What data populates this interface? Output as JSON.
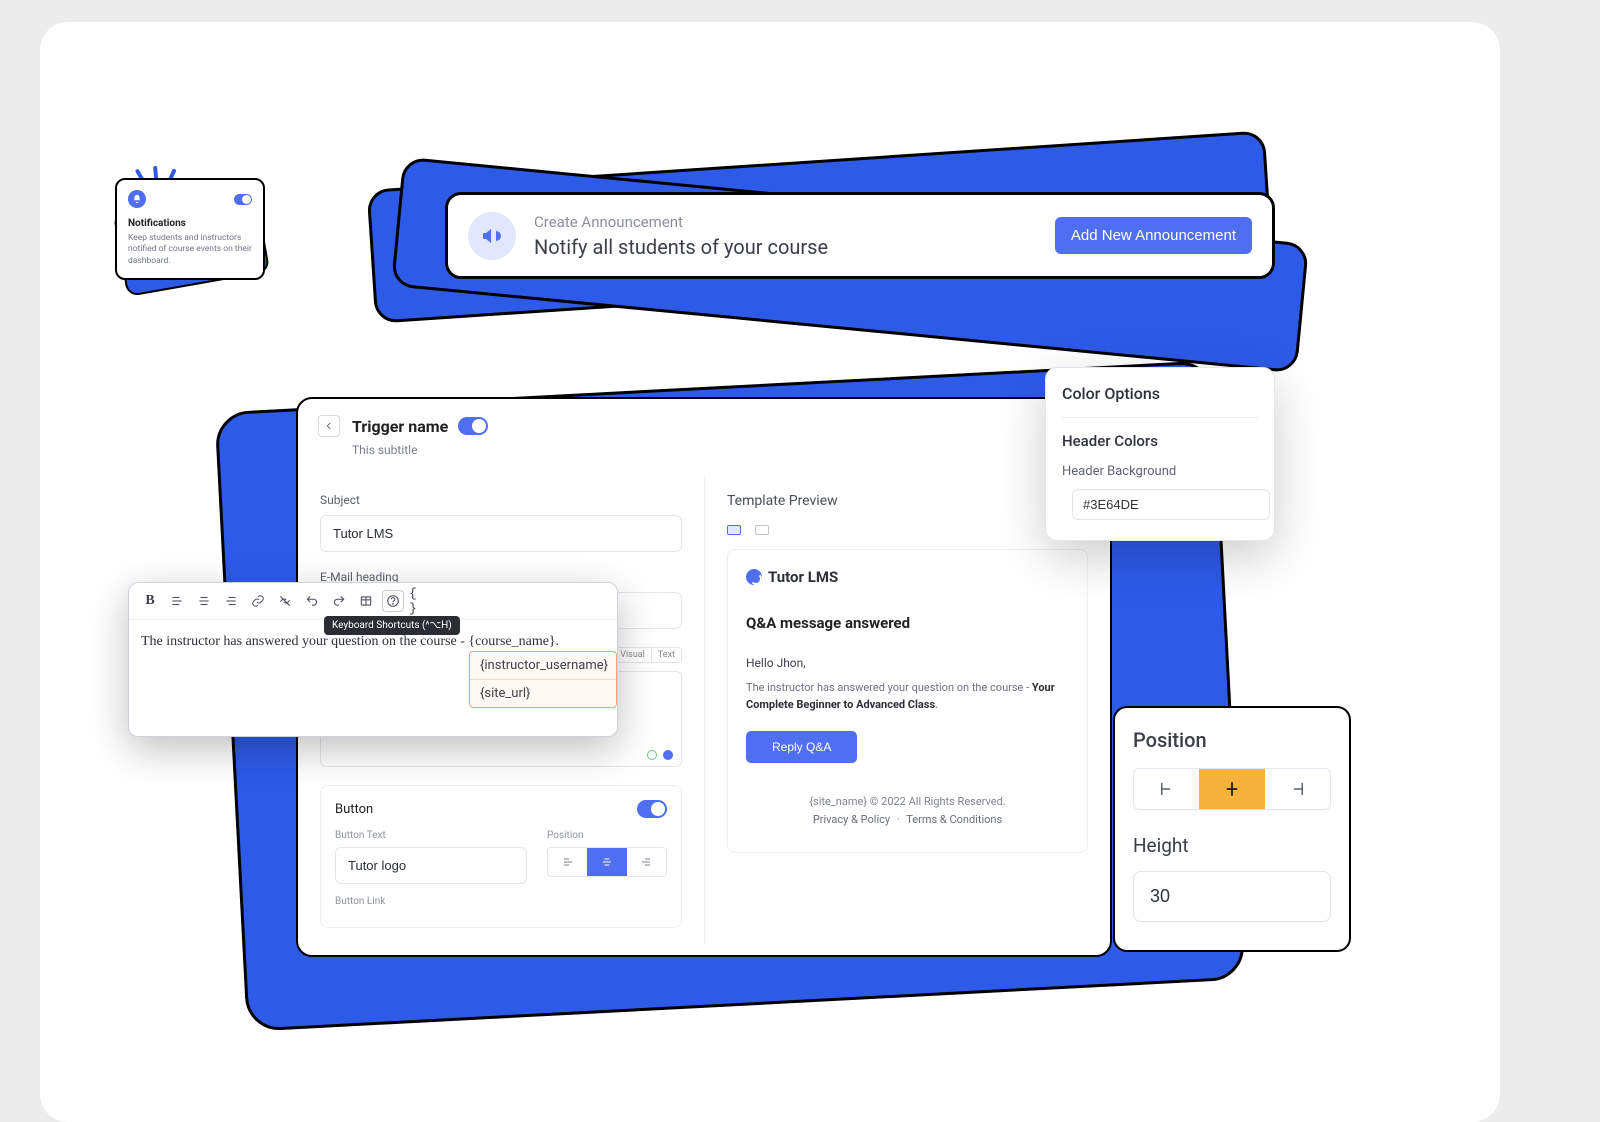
{
  "notifications": {
    "title": "Notifications",
    "description": "Keep students and instructors notified of course events on their dashboard."
  },
  "announcement": {
    "subtitle": "Create Announcement",
    "headline": "Notify all students of your course",
    "button_label": "Add New Announcement"
  },
  "trigger": {
    "title": "Trigger name",
    "subtitle": "This subtitle"
  },
  "editor_form": {
    "subject_label": "Subject",
    "subject_value": "Tutor LMS",
    "heading_label": "E-Mail heading",
    "view_toggle": {
      "visual": "Visual",
      "text": "Text"
    },
    "button_section": {
      "title": "Button",
      "text_label": "Button Text",
      "text_value": "Tutor logo",
      "position_label": "Position",
      "link_label": "Button Link"
    }
  },
  "rte": {
    "tooltip": "Keyboard Shortcuts (^⌥H)",
    "content": "The instructor has answered your question on the course - {course_name}.",
    "variables": [
      "{instructor_username}",
      "{site_url}"
    ]
  },
  "preview": {
    "title": "Template Preview",
    "brand": "Tutor LMS",
    "heading": "Q&A message answered",
    "greeting": "Hello Jhon,",
    "body_lead": "The instructor has answered your question on the course - ",
    "body_course": "Your Complete Beginner to Advanced Class",
    "cta_label": "Reply Q&A",
    "footer_line": "{site_name} © 2022 All Rights Reserved.",
    "footer_privacy": "Privacy & Policy",
    "footer_terms": "Terms & Conditions"
  },
  "color_options": {
    "title": "Color Options",
    "section_title": "Header Colors",
    "bg_label": "Header Background",
    "bg_value": "#3E64DE",
    "swatch": "#2e5ae8"
  },
  "position_panel": {
    "title": "Position",
    "height_label": "Height",
    "height_value": "30"
  }
}
